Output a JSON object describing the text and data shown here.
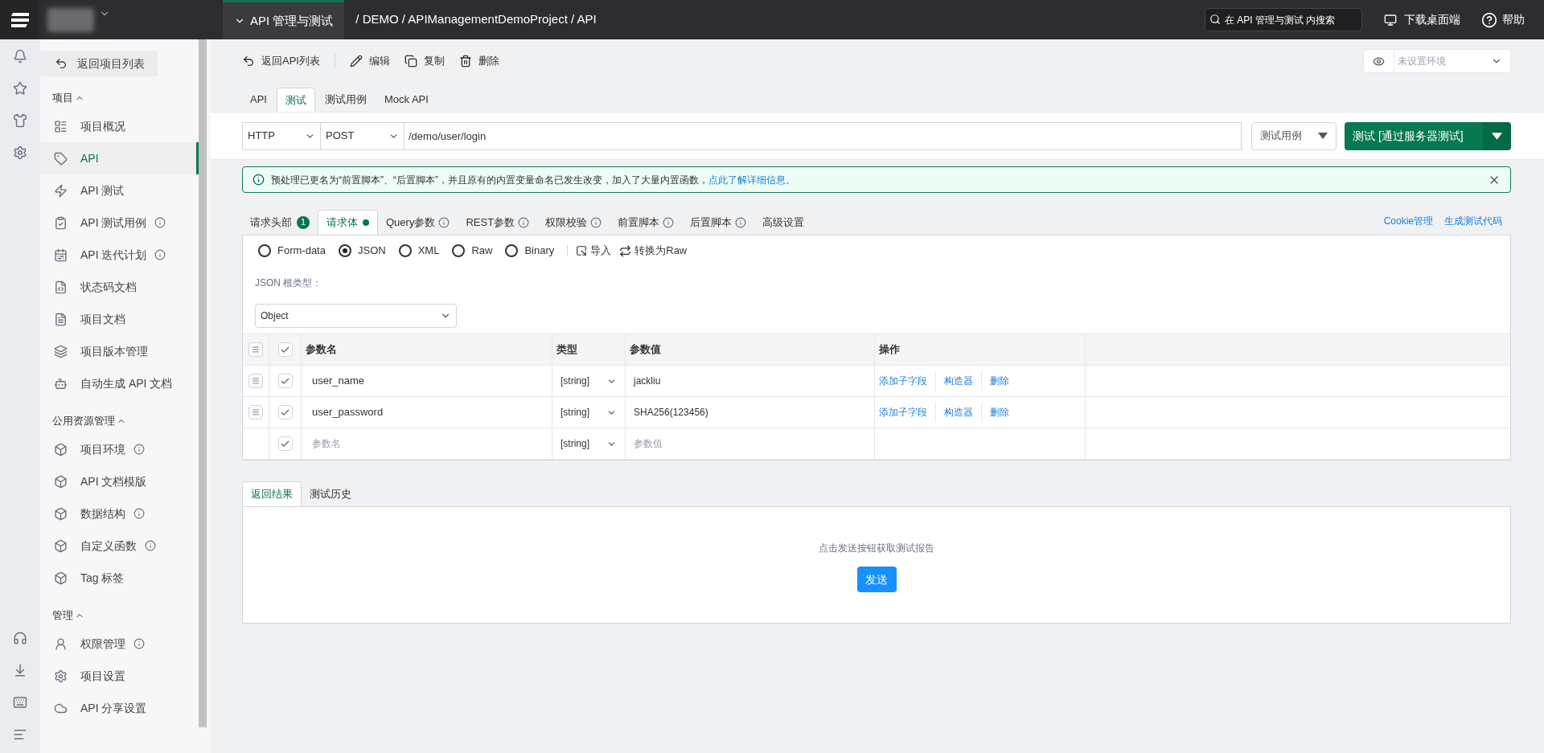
{
  "top_bar": {
    "module_tab": "API 管理与测试",
    "breadcrumb": "/ DEMO / APIManagementDemoProject / API",
    "search": {
      "placeholder": "在 API 管理与测试 内搜索"
    },
    "download": "下载桌面端",
    "help": "帮助"
  },
  "sidebar": {
    "back_button": "返回项目列表",
    "sections": [
      {
        "title": "项目",
        "expanded": true,
        "items": [
          {
            "label": "项目概况",
            "selected": false,
            "info": false
          },
          {
            "label": "API",
            "selected": true,
            "info": false
          },
          {
            "label": "API 测试",
            "selected": false,
            "info": false
          },
          {
            "label": "API 测试用例",
            "selected": false,
            "info": true
          },
          {
            "label": "API 迭代计划",
            "selected": false,
            "info": true
          },
          {
            "label": "状态码文档",
            "selected": false,
            "info": false
          },
          {
            "label": "项目文档",
            "selected": false,
            "info": false
          },
          {
            "label": "项目版本管理",
            "selected": false,
            "info": false
          },
          {
            "label": "自动生成 API 文档",
            "selected": false,
            "info": false
          }
        ]
      },
      {
        "title": "公用资源管理",
        "expanded": true,
        "items": [
          {
            "label": "项目环境",
            "selected": false,
            "info": true
          },
          {
            "label": "API 文档模版",
            "selected": false,
            "info": false
          },
          {
            "label": "数据结构",
            "selected": false,
            "info": true
          },
          {
            "label": "自定义函数",
            "selected": false,
            "info": true
          },
          {
            "label": "Tag 标签",
            "selected": false,
            "info": false
          }
        ]
      },
      {
        "title": "管理",
        "expanded": true,
        "items": [
          {
            "label": "权限管理",
            "selected": false,
            "info": true
          },
          {
            "label": "项目设置",
            "selected": false,
            "info": false
          },
          {
            "label": "API 分享设置",
            "selected": false,
            "info": false
          }
        ]
      }
    ]
  },
  "toolbar": {
    "actions": [
      "返回API列表",
      "编辑",
      "复制",
      "删除"
    ],
    "environment": {
      "placeholder": "未设置环境"
    }
  },
  "tabs": [
    {
      "label": "API",
      "selected": false
    },
    {
      "label": "测试",
      "selected": true
    },
    {
      "label": "测试用例",
      "selected": false
    },
    {
      "label": "Mock API",
      "selected": false
    }
  ],
  "request": {
    "protocol": "HTTP",
    "method": "POST",
    "url": "/demo/user/login",
    "case_select": "测试用例",
    "test_button": "测试 [通过服务器测试]"
  },
  "alert": {
    "text": "预处理已更名为“前置脚本”、“后置脚本”，并且原有的内置变量命名已发生改变，加入了大量内置函数，",
    "link": "点此了解详细信息。"
  },
  "sub_tabs": [
    {
      "label": "请求头部",
      "selected": false,
      "badge": "1",
      "modified": false,
      "info": false
    },
    {
      "label": "请求体",
      "selected": true,
      "modified": true,
      "info": false
    },
    {
      "label": "Query参数",
      "selected": false,
      "modified": false,
      "info": true
    },
    {
      "label": "REST参数",
      "selected": false,
      "modified": false,
      "info": true
    },
    {
      "label": "权限校验",
      "selected": false,
      "modified": false,
      "info": true
    },
    {
      "label": "前置脚本",
      "selected": false,
      "modified": false,
      "info": true
    },
    {
      "label": "后置脚本",
      "selected": false,
      "modified": false,
      "info": true
    },
    {
      "label": "高级设置",
      "selected": false,
      "modified": false,
      "info": false
    }
  ],
  "sub_links": [
    "Cookie管理",
    "生成测试代码"
  ],
  "body": {
    "formats": [
      {
        "label": "Form-data",
        "selected": false
      },
      {
        "label": "JSON",
        "selected": true
      },
      {
        "label": "XML",
        "selected": false
      },
      {
        "label": "Raw",
        "selected": false
      },
      {
        "label": "Binary",
        "selected": false
      }
    ],
    "import": "导入",
    "convert": "转换为Raw",
    "root_type_label": "JSON 根类型：",
    "root_type": "Object",
    "table": {
      "all_checked": true,
      "columns": [
        "参数名",
        "类型",
        "参数值",
        "操作"
      ],
      "rows": [
        {
          "kind": "param",
          "checked": true,
          "name": "user_name",
          "type": "[string]",
          "value": "jackliu",
          "actions": [
            "添加子字段",
            "构造器",
            "删除"
          ]
        },
        {
          "kind": "param",
          "checked": true,
          "name": "user_password",
          "type": "[string]",
          "value": "SHA256(123456)",
          "actions": [
            "添加子字段",
            "构造器",
            "删除"
          ]
        },
        {
          "kind": "new",
          "checked": true,
          "name_placeholder": "参数名",
          "type": "[string]",
          "value_placeholder": "参数值"
        }
      ]
    }
  },
  "result": {
    "tabs": [
      {
        "label": "返回结果",
        "selected": true
      },
      {
        "label": "测试历史",
        "selected": false
      }
    ],
    "hint": "点击发送按钮获取测试报告",
    "send_button": "发送"
  }
}
